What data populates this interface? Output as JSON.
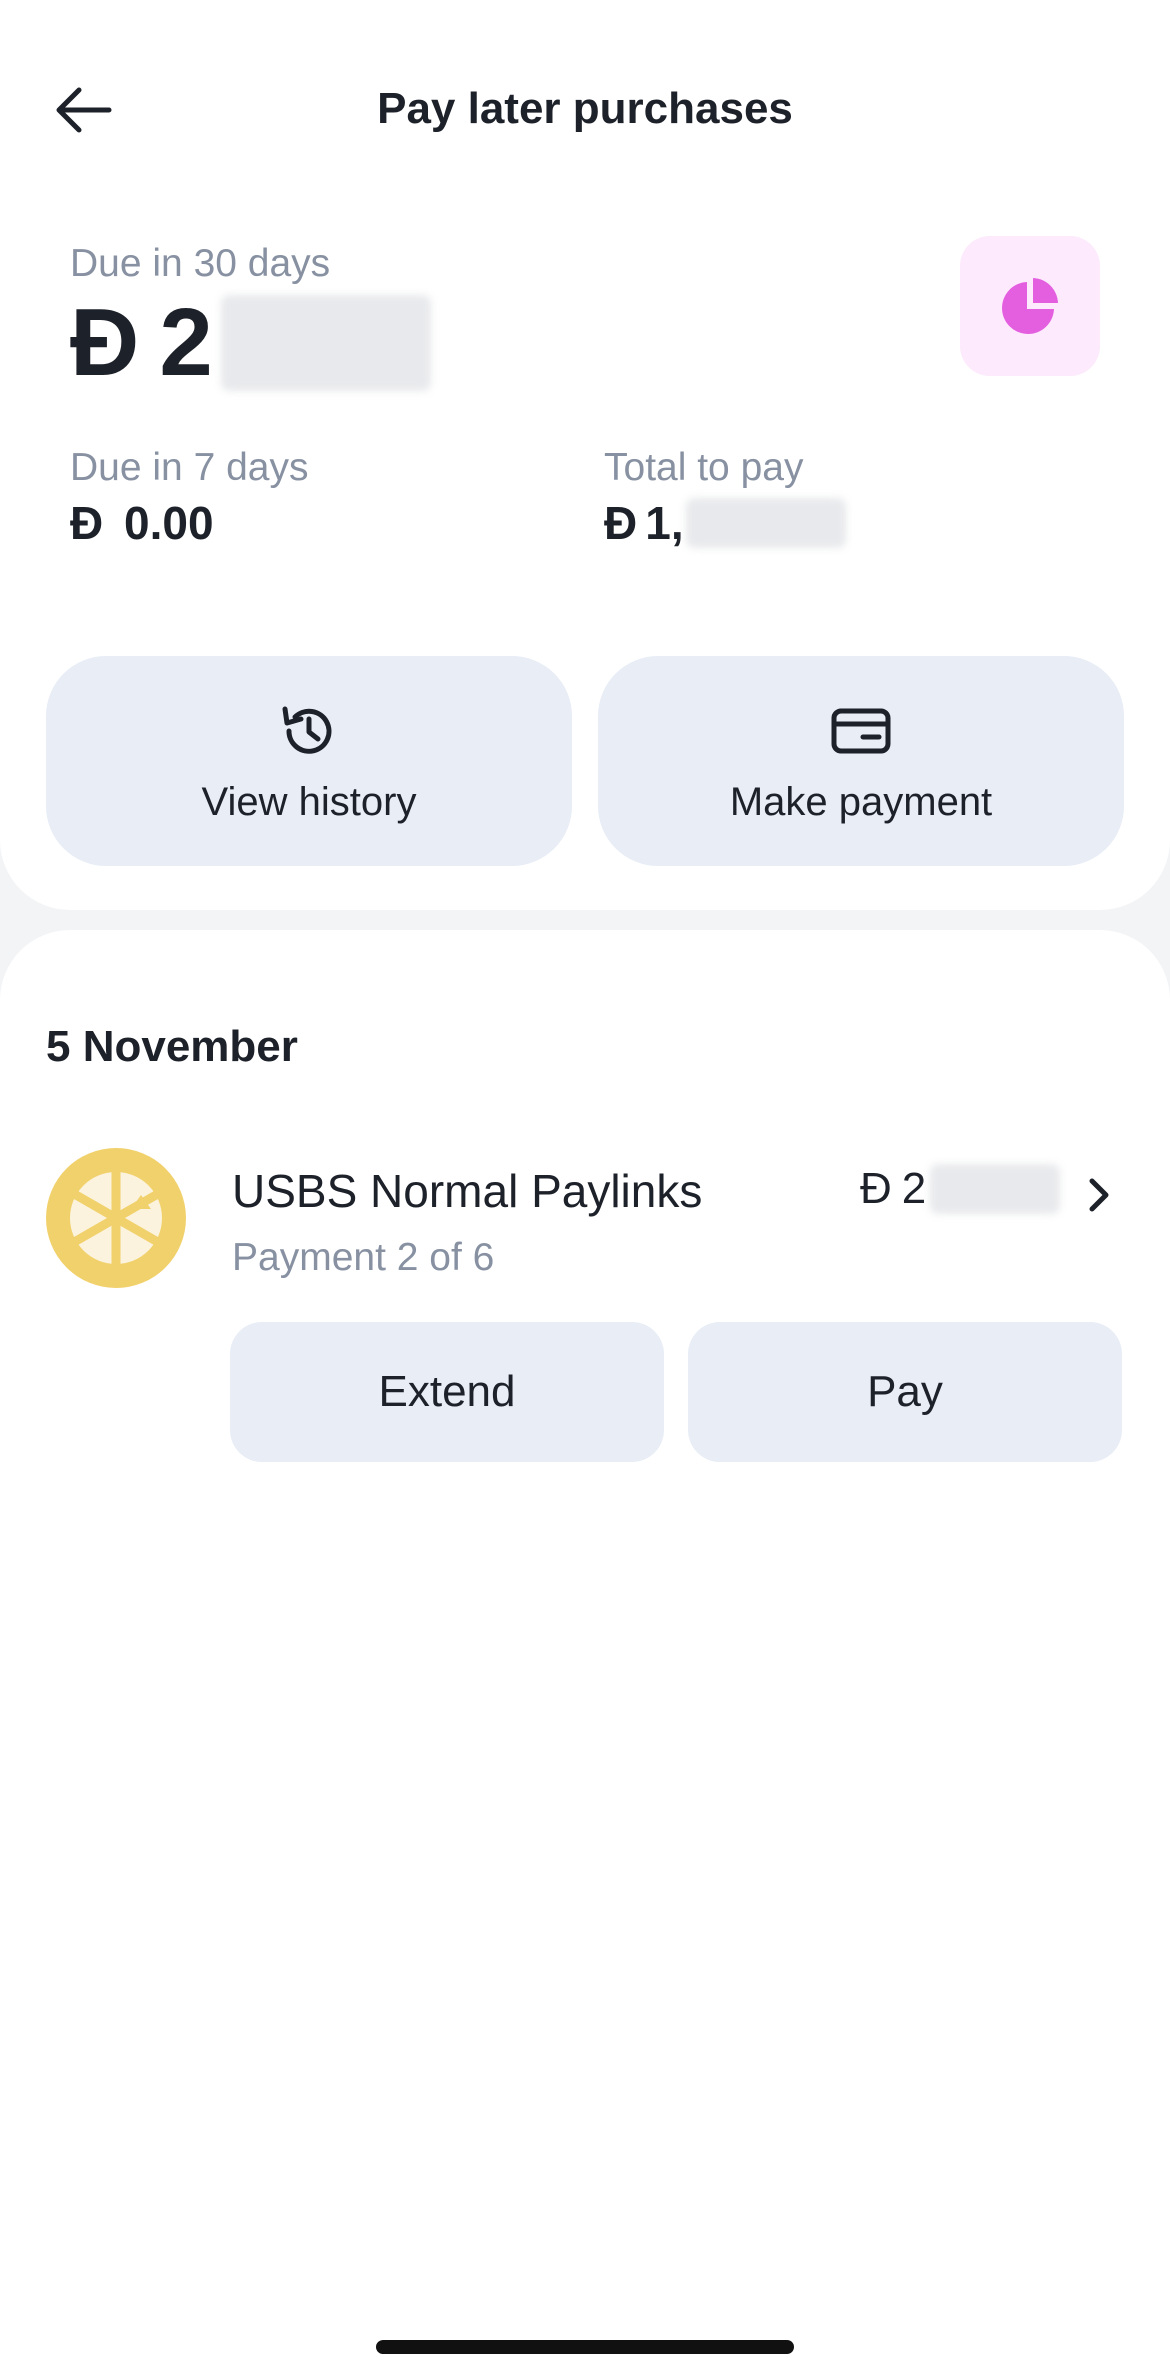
{
  "header": {
    "title": "Pay later purchases",
    "back_icon": "arrow-left-icon"
  },
  "summary": {
    "due30_label": "Due in 30 days",
    "due30_currency": "Đ",
    "due30_visible": "2",
    "due7_label": "Due in 7 days",
    "due7_currency": "Đ",
    "due7_amount": "0.00",
    "total_label": "Total to pay",
    "total_currency": "Đ",
    "total_visible": "1,",
    "insights_icon": "pie-chart-icon"
  },
  "actions": {
    "history_label": "View history",
    "history_icon": "history-icon",
    "payment_label": "Make payment",
    "payment_icon": "card-icon"
  },
  "purchases": {
    "date": "5 November",
    "item": {
      "name": "USBS Normal Paylinks",
      "subtitle": "Payment 2 of 6",
      "currency": "Đ",
      "amount_visible": "2",
      "extend_label": "Extend",
      "pay_label": "Pay"
    }
  },
  "colors": {
    "accent_pink": "#e45fdf",
    "pink_bg": "#fdeafc",
    "button_bg": "#e8edf6",
    "muted_text": "#8791a2",
    "merchant_logo": "#f1d16c"
  }
}
